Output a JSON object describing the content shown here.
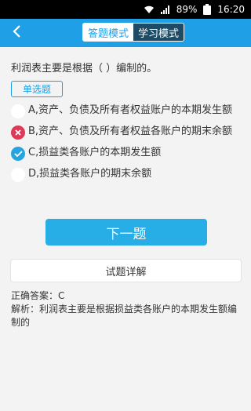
{
  "status_bar": {
    "battery": "89%",
    "time": "16:20"
  },
  "header": {
    "tabs": [
      {
        "label": "答题模式",
        "active": true
      },
      {
        "label": "学习模式",
        "active": false
      }
    ]
  },
  "question": {
    "text": "利润表主要是根据（ ）编制的。",
    "type_label": "单选题",
    "options": [
      {
        "label": "A,资产、负债及所有者权益账户的本期发生额",
        "state": "none"
      },
      {
        "label": "B,资产、负债及所有者权益各账户的期末余额",
        "state": "wrong"
      },
      {
        "label": "C,损益类各账户的本期发生额",
        "state": "correct"
      },
      {
        "label": "D,损益类各账户的期末余额",
        "state": "none"
      }
    ]
  },
  "buttons": {
    "next": "下一题",
    "detail": "试题详解"
  },
  "answer": {
    "correct_line": "正确答案：C",
    "explanation": "解析：利润表主要是根据损益类各账户的本期发生额编制的"
  },
  "colors": {
    "primary": "#1fa0e6",
    "wrong": "#dd3a57",
    "correct": "#27a4de"
  },
  "icons": {
    "wifi": "wifi-icon",
    "signal": "signal-icon",
    "battery": "battery-icon",
    "back": "chevron-left-icon",
    "wrong": "x-icon",
    "correct": "check-icon"
  }
}
